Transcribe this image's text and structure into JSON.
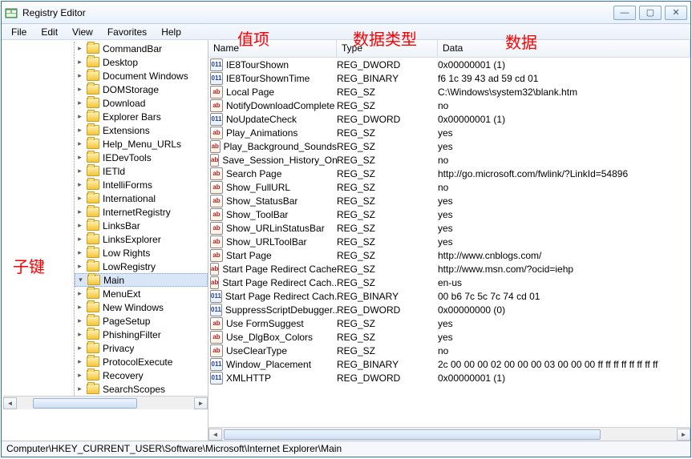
{
  "window": {
    "title": "Registry Editor"
  },
  "winbuttons": {
    "min": "—",
    "max": "▢",
    "close": "✕"
  },
  "menu": {
    "file": "File",
    "edit": "Edit",
    "view": "View",
    "favorites": "Favorites",
    "help": "Help"
  },
  "annotations": {
    "sub_keys": "子键",
    "value_items": "值项",
    "data_type": "数据类型",
    "data": "数据"
  },
  "columns": {
    "name": "Name",
    "type": "Type",
    "data": "Data"
  },
  "statusbar": "Computer\\HKEY_CURRENT_USER\\Software\\Microsoft\\Internet Explorer\\Main",
  "tree_nodes": [
    {
      "label": "CommandBar"
    },
    {
      "label": "Desktop"
    },
    {
      "label": "Document Windows"
    },
    {
      "label": "DOMStorage"
    },
    {
      "label": "Download"
    },
    {
      "label": "Explorer Bars"
    },
    {
      "label": "Extensions"
    },
    {
      "label": "Help_Menu_URLs"
    },
    {
      "label": "IEDevTools"
    },
    {
      "label": "IETld"
    },
    {
      "label": "IntelliForms"
    },
    {
      "label": "International"
    },
    {
      "label": "InternetRegistry"
    },
    {
      "label": "LinksBar"
    },
    {
      "label": "LinksExplorer"
    },
    {
      "label": "Low Rights"
    },
    {
      "label": "LowRegistry"
    },
    {
      "label": "Main",
      "selected": true
    },
    {
      "label": "MenuExt"
    },
    {
      "label": "New Windows"
    },
    {
      "label": "PageSetup"
    },
    {
      "label": "PhishingFilter"
    },
    {
      "label": "Privacy"
    },
    {
      "label": "ProtocolExecute"
    },
    {
      "label": "Recovery"
    },
    {
      "label": "SearchScopes"
    }
  ],
  "values": [
    {
      "icon": "binary",
      "name": "IE8TourShown",
      "type": "REG_DWORD",
      "data": "0x00000001 (1)"
    },
    {
      "icon": "binary",
      "name": "IE8TourShownTime",
      "type": "REG_BINARY",
      "data": "f6 1c 39 43 ad 59 cd 01"
    },
    {
      "icon": "string",
      "name": "Local Page",
      "type": "REG_SZ",
      "data": "C:\\Windows\\system32\\blank.htm"
    },
    {
      "icon": "string",
      "name": "NotifyDownloadComplete",
      "type": "REG_SZ",
      "data": "no"
    },
    {
      "icon": "binary",
      "name": "NoUpdateCheck",
      "type": "REG_DWORD",
      "data": "0x00000001 (1)"
    },
    {
      "icon": "string",
      "name": "Play_Animations",
      "type": "REG_SZ",
      "data": "yes"
    },
    {
      "icon": "string",
      "name": "Play_Background_Sounds",
      "type": "REG_SZ",
      "data": "yes"
    },
    {
      "icon": "string",
      "name": "Save_Session_History_On...",
      "type": "REG_SZ",
      "data": "no"
    },
    {
      "icon": "string",
      "name": "Search Page",
      "type": "REG_SZ",
      "data": "http://go.microsoft.com/fwlink/?LinkId=54896"
    },
    {
      "icon": "string",
      "name": "Show_FullURL",
      "type": "REG_SZ",
      "data": "no"
    },
    {
      "icon": "string",
      "name": "Show_StatusBar",
      "type": "REG_SZ",
      "data": "yes"
    },
    {
      "icon": "string",
      "name": "Show_ToolBar",
      "type": "REG_SZ",
      "data": "yes"
    },
    {
      "icon": "string",
      "name": "Show_URLinStatusBar",
      "type": "REG_SZ",
      "data": "yes"
    },
    {
      "icon": "string",
      "name": "Show_URLToolBar",
      "type": "REG_SZ",
      "data": "yes"
    },
    {
      "icon": "string",
      "name": "Start Page",
      "type": "REG_SZ",
      "data": "http://www.cnblogs.com/"
    },
    {
      "icon": "string",
      "name": "Start Page Redirect Cache",
      "type": "REG_SZ",
      "data": "http://www.msn.com/?ocid=iehp"
    },
    {
      "icon": "string",
      "name": "Start Page Redirect Cach...",
      "type": "REG_SZ",
      "data": "en-us"
    },
    {
      "icon": "binary",
      "name": "Start Page Redirect Cach...",
      "type": "REG_BINARY",
      "data": "00 b6 7c 5c 7c 74 cd 01"
    },
    {
      "icon": "binary",
      "name": "SuppressScriptDebugger...",
      "type": "REG_DWORD",
      "data": "0x00000000 (0)"
    },
    {
      "icon": "string",
      "name": "Use FormSuggest",
      "type": "REG_SZ",
      "data": "yes"
    },
    {
      "icon": "string",
      "name": "Use_DlgBox_Colors",
      "type": "REG_SZ",
      "data": "yes"
    },
    {
      "icon": "string",
      "name": "UseClearType",
      "type": "REG_SZ",
      "data": "no"
    },
    {
      "icon": "binary",
      "name": "Window_Placement",
      "type": "REG_BINARY",
      "data": "2c 00 00 00 02 00 00 00 03 00 00 00 ff ff ff ff ff ff ff ff"
    },
    {
      "icon": "binary",
      "name": "XMLHTTP",
      "type": "REG_DWORD",
      "data": "0x00000001 (1)"
    }
  ]
}
